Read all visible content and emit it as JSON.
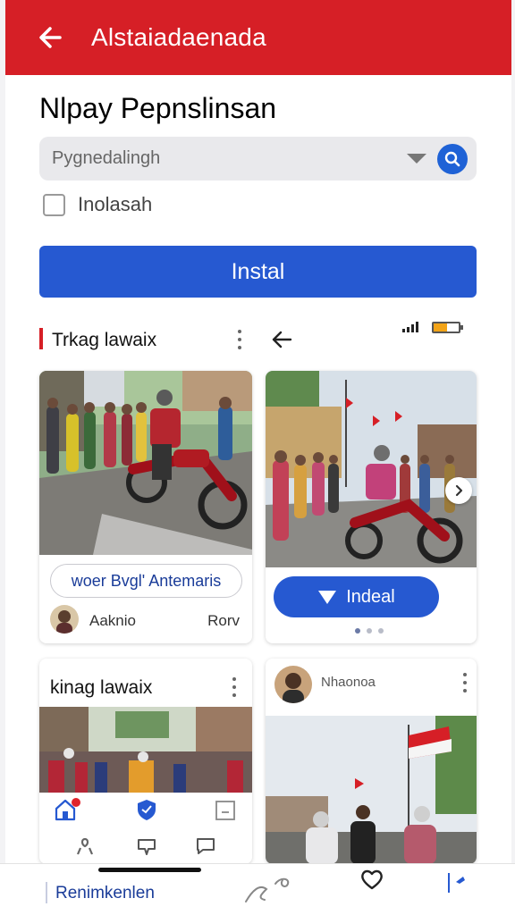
{
  "header": {
    "title": "Alstaiadaenada",
    "bg_color": "#d61f26"
  },
  "page": {
    "title": "Nlpay Pepnslinsan"
  },
  "search": {
    "placeholder": "Pygnedalingh"
  },
  "option": {
    "label": "Inolasah",
    "checked": false
  },
  "install_button": {
    "label": "Instal",
    "color": "#2659d1"
  },
  "section": {
    "title": "Trkag lawaix"
  },
  "status": {
    "battery_level": 0.55
  },
  "cards": {
    "first": {
      "pill": "woer Bvgl' Antemaris",
      "author": "Aaknio",
      "tag": "Rorv"
    },
    "second": {
      "button": "Indeal",
      "dots_count": 3,
      "active_dot": 1
    },
    "third": {
      "title": "kinag lawaix"
    },
    "fourth": {
      "author": "Nhaonoa"
    }
  },
  "bottom": {
    "label": "Renimkenlen"
  },
  "icons": [
    "back-arrow-icon",
    "search-icon",
    "dropdown-caret-icon",
    "kebab-menu-icon",
    "signal-icon",
    "battery-icon",
    "play-icon",
    "chevron-right-icon",
    "home-icon",
    "shield-icon",
    "bookmark-icon",
    "ribbon-icon",
    "comment-icon",
    "chat-icon",
    "scribble-icon",
    "heart-icon",
    "pin-icon"
  ]
}
